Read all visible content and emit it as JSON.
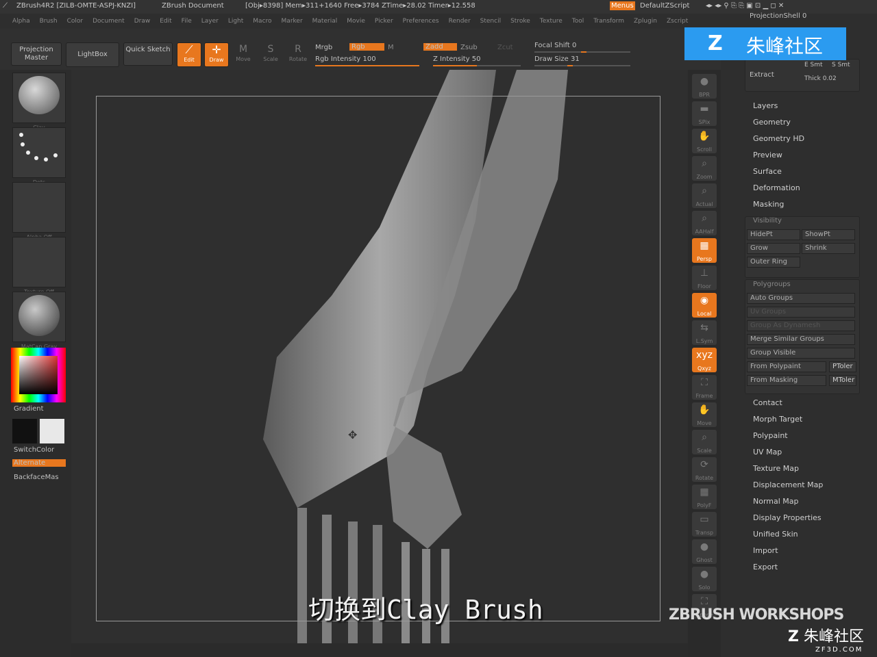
{
  "titlebar": {
    "app": "ZBrush4R2 [ZILB-OMTE-ASPJ-KNZI]",
    "doc": "ZBrush Document",
    "stats": "[Obj▸8398] Mem▸311+1640 Free▸3784 ZTime▸28.02 Timer▸12.558",
    "menus_btn": "Menus",
    "script": "DefaultZScript"
  },
  "menubar": [
    "Alpha",
    "Brush",
    "Color",
    "Document",
    "Draw",
    "Edit",
    "File",
    "Layer",
    "Light",
    "Macro",
    "Marker",
    "Material",
    "Movie",
    "Picker",
    "Preferences",
    "Render",
    "Stencil",
    "Stroke",
    "Texture",
    "Tool",
    "Transform",
    "Zplugin",
    "Zscript"
  ],
  "toolbar": {
    "projection_master": "Projection Master",
    "lightbox": "LightBox",
    "quick_sketch": "Quick Sketch",
    "edit": "Edit",
    "draw": "Draw",
    "move": "Move",
    "scale": "Scale",
    "rotate": "Rotate",
    "mrgb": "Mrgb",
    "rgb": "Rgb",
    "m": "M",
    "rgb_intensity": "Rgb Intensity 100",
    "zadd": "Zadd",
    "zsub": "Zsub",
    "zcut": "Zcut",
    "z_intensity": "Z Intensity 50",
    "focal_shift": "Focal Shift 0",
    "draw_size": "Draw Size 31",
    "rgb_intensity_level": 1.0,
    "z_intensity_level": 0.5
  },
  "leftshelf": {
    "thumbs": [
      "Clay",
      "Dots",
      "Alpha Off",
      "Texture Off",
      "MatCap Gray"
    ],
    "gradient": "Gradient",
    "switchcolor": "SwitchColor",
    "alternate": "Alternate",
    "backface": "BackfaceMas"
  },
  "rightshelf": [
    "BPR",
    "SPix",
    "Scroll",
    "Zoom",
    "Actual",
    "AAHalf",
    "Persp",
    "Floor",
    "Local",
    "L.Sym",
    "Qxyz",
    "Frame",
    "Move",
    "Scale",
    "Rotate",
    "PolyF",
    "Transp",
    "Ghost",
    "Solo",
    "Xpose"
  ],
  "rightpanel": {
    "projection_shell": "ProjectionShell 0",
    "extract": "Extract",
    "e_smt": "E Smt",
    "s_smt": "S Smt",
    "thick": "Thick 0.02",
    "sections_top": [
      "Layers",
      "Geometry",
      "Geometry HD",
      "Preview",
      "Surface",
      "Deformation",
      "Masking"
    ],
    "visibility": {
      "title": "Visibility",
      "buttons": [
        "HidePt",
        "ShowPt",
        "Grow",
        "Shrink",
        "Outer Ring"
      ]
    },
    "polygroups": {
      "title": "Polygroups",
      "buttons": [
        "Auto Groups",
        "Uv Groups",
        "Group As Dynamesh",
        "Merge Similar Groups",
        "Group Visible",
        "From Polypaint",
        "From Masking"
      ],
      "ptoler": "PToler",
      "mtoler": "MToler"
    },
    "sections_bottom": [
      "Contact",
      "Morph Target",
      "Polypaint",
      "UV Map",
      "Texture Map",
      "Displacement Map",
      "Normal Map",
      "Display Properties",
      "Unified Skin",
      "Import",
      "Export"
    ]
  },
  "subtitle": "切换到Clay Brush",
  "watermark": "朱峰社区",
  "workshops": "ZBRUSH WORKSHOPS",
  "zf3d": {
    "name": "朱峰社区",
    "url": "ZF3D.COM"
  },
  "colors": {
    "accent": "#e8771e",
    "bg": "#2b2b2b",
    "watermark": "#2b9bf0"
  }
}
